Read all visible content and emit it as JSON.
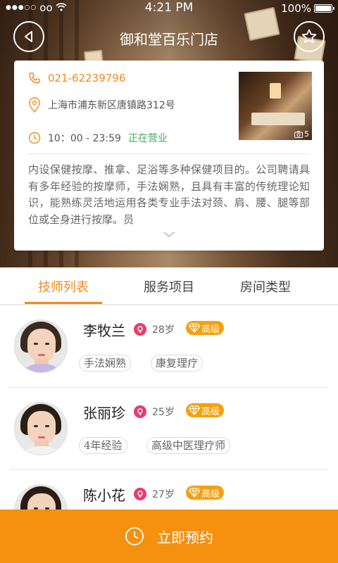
{
  "status_bar": {
    "carrier": "●●●○○",
    "carrier_name": "oo",
    "time": "4:21 PM",
    "battery": "100%"
  },
  "header": {
    "title": "御和堂百乐门店",
    "back_icon": "back-triangle-icon",
    "favorite_icon": "star-icon"
  },
  "store": {
    "phone": "021-62239796",
    "address": "上海市浦东新区唐镇路312号",
    "hours": "10：00 - 23:59",
    "status": "正在营业",
    "photo_count": "5",
    "description": "内设保健按摩、推拿、足浴等多种保健项目的。公司聘请具有多年经验的按摩师，手法娴熟，且具有丰富的传统理论知识，能熟练灵活地运用各类专业手法对颈、肩、腰、腿等部位或全身进行按摩。员"
  },
  "tabs": [
    {
      "label": "技师列表",
      "active": true
    },
    {
      "label": "服务项目",
      "active": false
    },
    {
      "label": "房间类型",
      "active": false
    }
  ],
  "technicians": [
    {
      "name": "李牧兰",
      "age": "28岁",
      "level": "高级",
      "tags": [
        "手法娴熟",
        "康复理疗"
      ],
      "shirt_color": "#c9b6e4"
    },
    {
      "name": "张丽珍",
      "age": "25岁",
      "level": "高级",
      "tags": [
        "4年经验",
        "高级中医理疗师"
      ],
      "shirt_color": "#f2f2f2"
    },
    {
      "name": "陈小花",
      "age": "27岁",
      "level": "高级",
      "tags": [],
      "shirt_color": "#f5d6dc"
    }
  ],
  "book_button": {
    "label": "立即预约"
  },
  "colors": {
    "accent": "#f4891f",
    "open_status": "#3fae59",
    "gender_badge": "#ea3b6e",
    "level_badge": "#f6a010",
    "book_bar": "#f6900f"
  }
}
